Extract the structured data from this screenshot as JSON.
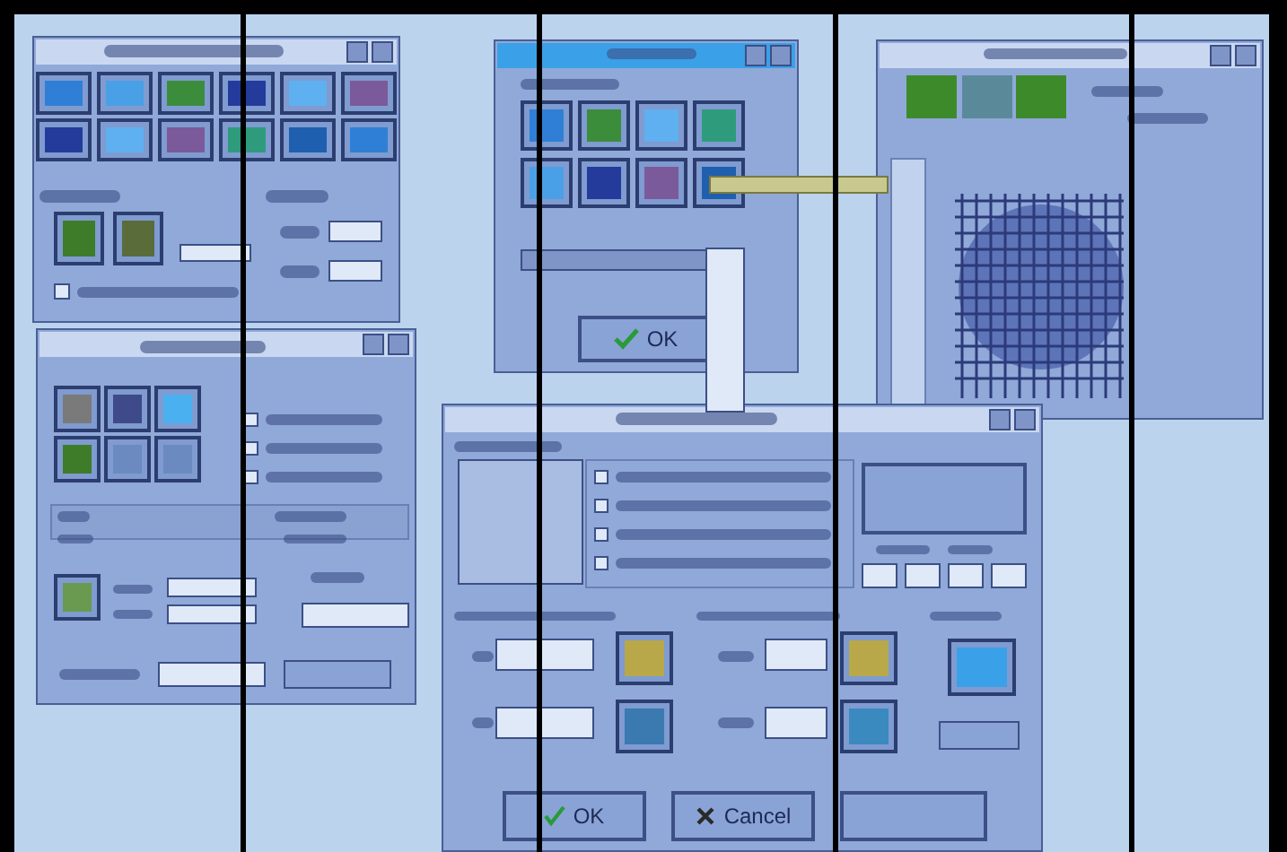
{
  "top_left_window": {
    "checkbox": {
      "checked": false
    }
  },
  "center_window": {
    "ok_button": {
      "label": "OK"
    }
  },
  "setup_window": {
    "checkboxes": [
      {
        "checked": false
      },
      {
        "checked": false
      },
      {
        "checked": false
      }
    ]
  },
  "dialog": {
    "checkboxes": [
      {
        "checked": false
      },
      {
        "checked": false
      },
      {
        "checked": false
      },
      {
        "checked": false
      }
    ],
    "buttons": [
      {
        "label": "OK",
        "kind": "ok"
      },
      {
        "label": "Cancel",
        "kind": "cancel"
      }
    ]
  }
}
